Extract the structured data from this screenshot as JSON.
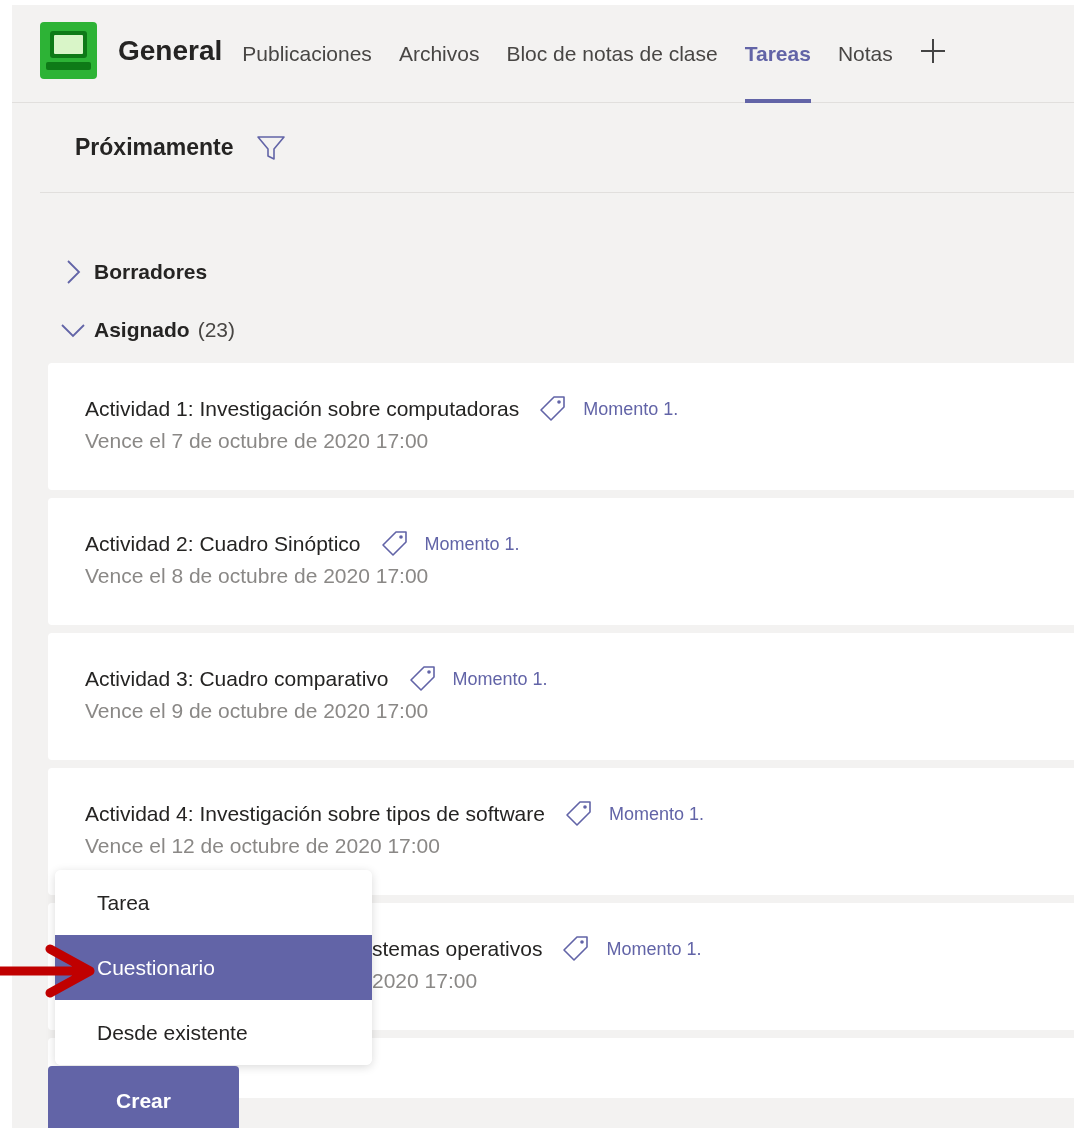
{
  "header": {
    "team": "General",
    "tabs": [
      {
        "label": "Publicaciones",
        "selected": false
      },
      {
        "label": "Archivos",
        "selected": false
      },
      {
        "label": "Bloc de notas de clase",
        "selected": false
      },
      {
        "label": "Tareas",
        "selected": true
      },
      {
        "label": "Notas",
        "selected": false
      }
    ]
  },
  "toolbar": {
    "title": "Próximamente"
  },
  "sections": [
    {
      "label": "Borradores",
      "expanded": false
    },
    {
      "label": "Asignado",
      "count": "(23)",
      "expanded": true
    }
  ],
  "assignments": [
    {
      "kind": "full",
      "title": "Actividad 1: Investigación sobre computadoras",
      "tag": "Momento 1.",
      "due": "Vence el 7 de octubre de 2020 17:00"
    },
    {
      "kind": "full",
      "title": "Actividad 2: Cuadro Sinóptico",
      "tag": "Momento 1.",
      "due": "Vence el 8 de octubre de 2020 17:00"
    },
    {
      "kind": "full",
      "title": "Actividad 3: Cuadro comparativo",
      "tag": "Momento 1.",
      "due": "Vence el 9 de octubre de 2020 17:00"
    },
    {
      "kind": "full",
      "title": "Actividad 4: Investigación sobre tipos de software",
      "tag": "Momento 1.",
      "due": "Vence el 12 de octubre de 2020 17:00"
    },
    {
      "kind": "covered",
      "title": "stemas operativos",
      "tag": "Momento 1.",
      "due": "2020 17:00"
    }
  ],
  "create_menu": {
    "items": [
      {
        "label": "Tarea",
        "selected": false
      },
      {
        "label": "Cuestionario",
        "selected": true
      },
      {
        "label": "Desde existente",
        "selected": false
      }
    ]
  },
  "create_button": "Crear"
}
